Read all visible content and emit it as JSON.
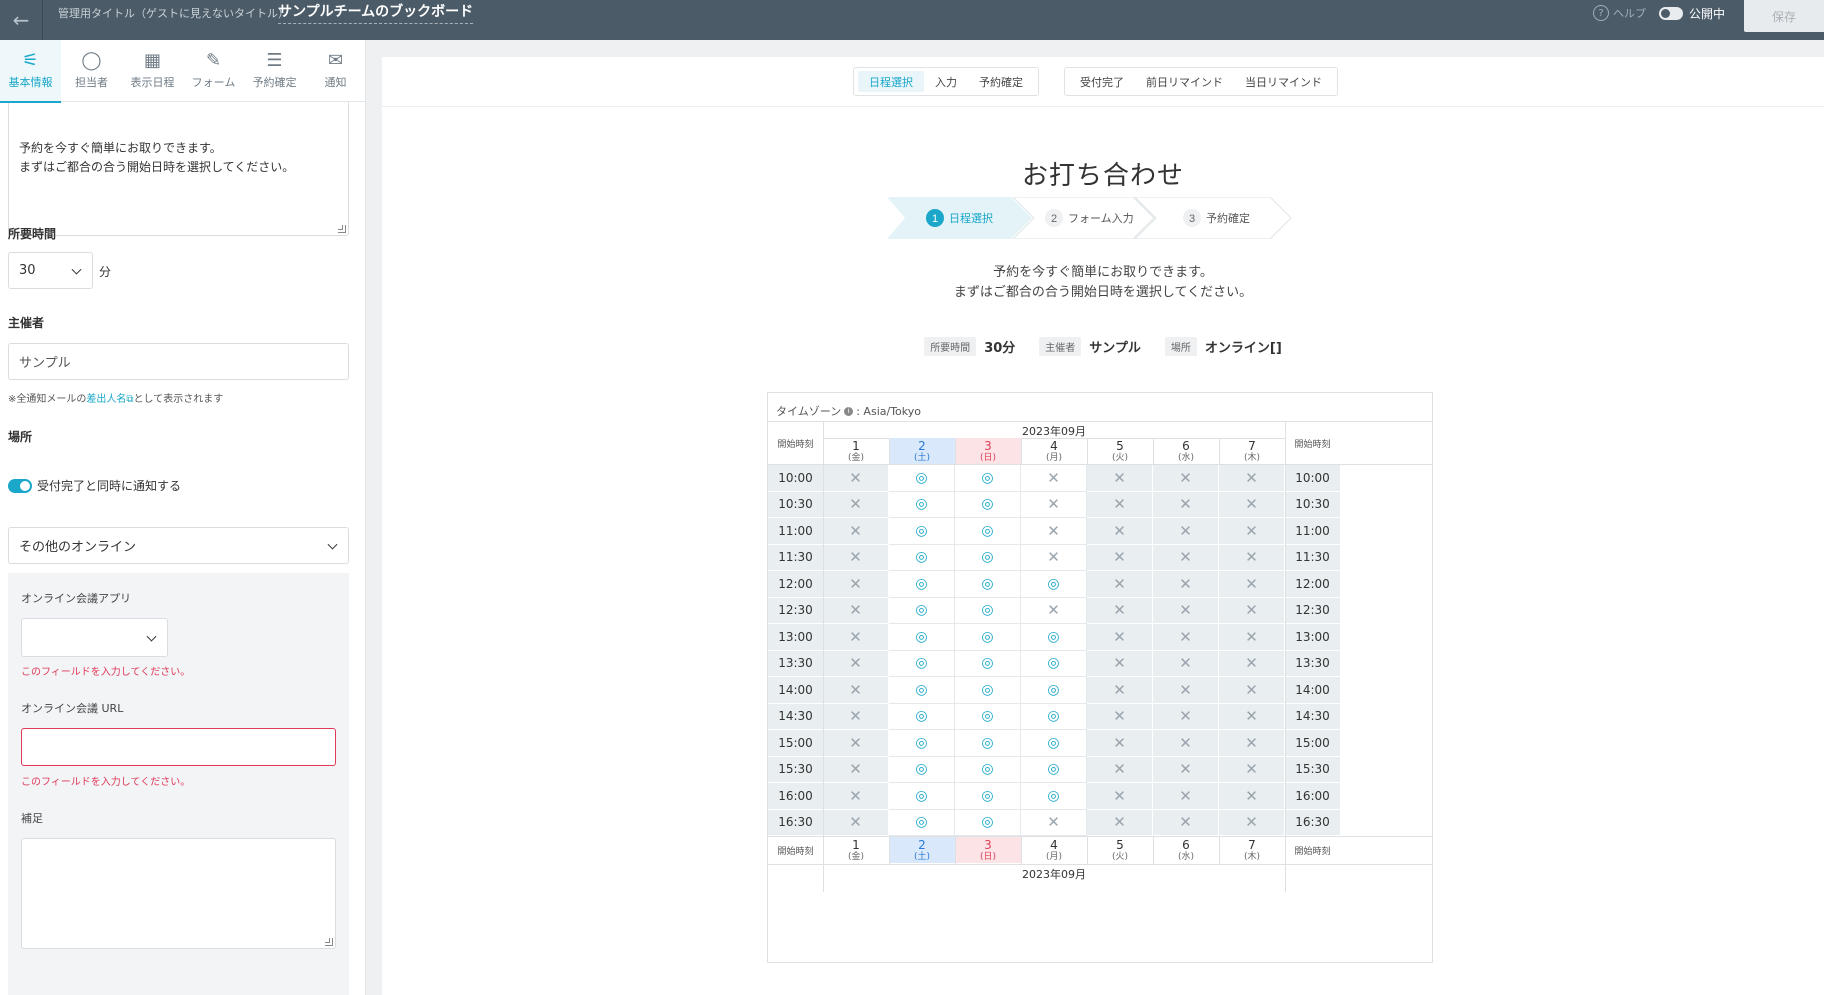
{
  "topbar": {
    "back_icon": "arrow-left-icon",
    "admin_label": "管理用タイトル（ゲストに見えないタイトル）",
    "board_title": "サンプルチームのブックボード",
    "help_label": "ヘルプ",
    "publish_label": "公開中",
    "save_label": "保存"
  },
  "sidebar": {
    "tabs": [
      {
        "label": "基本情報",
        "icon": "sliders-icon",
        "glyph": "⚟"
      },
      {
        "label": "担当者",
        "icon": "people-icon",
        "glyph": "👥"
      },
      {
        "label": "表示日程",
        "icon": "calendar-icon",
        "glyph": "▦"
      },
      {
        "label": "フォーム",
        "icon": "form-edit-icon",
        "glyph": "✎"
      },
      {
        "label": "予約確定",
        "icon": "checklist-icon",
        "glyph": "☰"
      },
      {
        "label": "通知",
        "icon": "mail-icon",
        "glyph": "✉"
      }
    ],
    "description_line1": "予約を今すぐ簡単にお取りできます。",
    "description_line2": "まずはご都合の合う開始日時を選択してください。",
    "duration_label": "所要時間",
    "duration_value": "30",
    "duration_unit": "分",
    "organizer_label": "主催者",
    "organizer_value": "サンプル",
    "organizer_note_pre": "※全通知メールの",
    "organizer_note_link": "差出人名",
    "organizer_note_post": "として表示されます",
    "location_label": "場所",
    "notify_toggle_label": "受付完了と同時に通知する",
    "location_type_value": "その他のオンライン",
    "online_app_label": "オンライン会議アプリ",
    "online_app_value": "",
    "field_error": "このフィールドを入力してください。",
    "online_url_label": "オンライン会議 URL",
    "online_url_value": "",
    "supplement_label": "補足"
  },
  "preview": {
    "nav_group1": [
      "日程選択",
      "入力",
      "予約確定"
    ],
    "nav_group2": [
      "受付完了",
      "前日リマインド",
      "当日リマインド"
    ],
    "title": "お打ち合わせ",
    "steps": [
      {
        "num": "1",
        "label": "日程選択"
      },
      {
        "num": "2",
        "label": "フォーム入力"
      },
      {
        "num": "3",
        "label": "予約確定"
      }
    ],
    "intro_line1": "予約を今すぐ簡単にお取りできます。",
    "intro_line2": "まずはご都合の合う開始日時を選択してください。",
    "meta": {
      "duration_tag": "所要時間",
      "duration_value": "30分",
      "organizer_tag": "主催者",
      "organizer_value": "サンプル",
      "place_tag": "場所",
      "place_value": "オンライン[]"
    }
  },
  "calendar": {
    "timezone_label": "タイムゾーン",
    "timezone_value": ": Asia/Tokyo",
    "month": "2023年09月",
    "start_label": "開始時刻",
    "days": [
      {
        "d": "1",
        "w": "(金)",
        "kind": "weekday"
      },
      {
        "d": "2",
        "w": "(土)",
        "kind": "sat"
      },
      {
        "d": "3",
        "w": "(日)",
        "kind": "sun"
      },
      {
        "d": "4",
        "w": "(月)",
        "kind": "weekday"
      },
      {
        "d": "5",
        "w": "(火)",
        "kind": "weekday"
      },
      {
        "d": "6",
        "w": "(水)",
        "kind": "weekday"
      },
      {
        "d": "7",
        "w": "(木)",
        "kind": "weekday"
      }
    ],
    "times": [
      "10:00",
      "10:30",
      "11:00",
      "11:30",
      "12:00",
      "12:30",
      "13:00",
      "13:30",
      "14:00",
      "14:30",
      "15:00",
      "15:30",
      "16:00",
      "16:30"
    ],
    "available_symbol": "◎",
    "unavailable_symbol": "✕",
    "slots": [
      [
        "x",
        "o",
        "o",
        "x",
        "x",
        "x",
        "x"
      ],
      [
        "x",
        "o",
        "o",
        "x",
        "x",
        "x",
        "x"
      ],
      [
        "x",
        "o",
        "o",
        "x",
        "x",
        "x",
        "x"
      ],
      [
        "x",
        "o",
        "o",
        "x",
        "x",
        "x",
        "x"
      ],
      [
        "x",
        "o",
        "o",
        "o",
        "x",
        "x",
        "x"
      ],
      [
        "x",
        "o",
        "o",
        "x",
        "x",
        "x",
        "x"
      ],
      [
        "x",
        "o",
        "o",
        "o",
        "x",
        "x",
        "x"
      ],
      [
        "x",
        "o",
        "o",
        "o",
        "x",
        "x",
        "x"
      ],
      [
        "x",
        "o",
        "o",
        "o",
        "x",
        "x",
        "x"
      ],
      [
        "x",
        "o",
        "o",
        "o",
        "x",
        "x",
        "x"
      ],
      [
        "x",
        "o",
        "o",
        "o",
        "x",
        "x",
        "x"
      ],
      [
        "x",
        "o",
        "o",
        "o",
        "x",
        "x",
        "x"
      ],
      [
        "x",
        "o",
        "o",
        "o",
        "x",
        "x",
        "x"
      ],
      [
        "x",
        "o",
        "o",
        "x",
        "x",
        "x",
        "x"
      ]
    ]
  },
  "colors": {
    "topbar": "#4b5b67",
    "accent": "#1aa7c9",
    "error": "#e0395a",
    "saturday": "#2a79d6",
    "sunday": "#e04159"
  }
}
